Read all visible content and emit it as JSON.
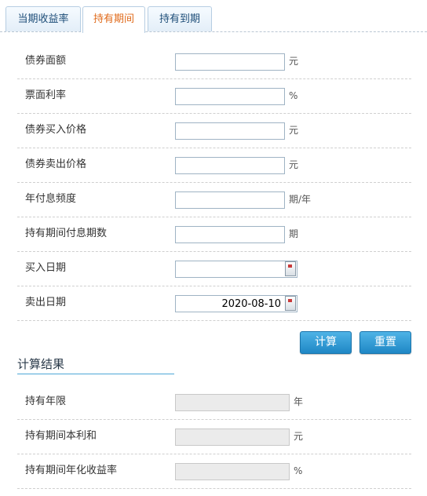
{
  "tabs": [
    {
      "label": "当期收益率"
    },
    {
      "label": "持有期间"
    },
    {
      "label": "持有到期"
    }
  ],
  "active_tab": 1,
  "colors": {
    "active_tab_text": "#e06a1a",
    "tab_text": "#1d4d78",
    "button": "#2a95d2"
  },
  "form": {
    "face_value": {
      "label": "债券面额",
      "unit": "元",
      "value": ""
    },
    "coupon_rate": {
      "label": "票面利率",
      "unit": "%",
      "value": ""
    },
    "buy_price": {
      "label": "债券买入价格",
      "unit": "元",
      "value": ""
    },
    "sell_price": {
      "label": "债券卖出价格",
      "unit": "元",
      "value": ""
    },
    "payment_freq": {
      "label": "年付息频度",
      "unit": "期/年",
      "value": ""
    },
    "payment_periods": {
      "label": "持有期间付息期数",
      "unit": "期",
      "value": ""
    },
    "buy_date": {
      "label": "买入日期",
      "value": "",
      "icon": "calendar-icon"
    },
    "sell_date": {
      "label": "卖出日期",
      "value": "2020-08-10",
      "icon": "calendar-icon"
    }
  },
  "buttons": {
    "calculate": "计算",
    "reset": "重置"
  },
  "result": {
    "title": "计算结果",
    "holding_years": {
      "label": "持有年限",
      "unit": "年",
      "value": ""
    },
    "principal_interest": {
      "label": "持有期间本利和",
      "unit": "元",
      "value": ""
    },
    "annual_yield": {
      "label": "持有期间年化收益率",
      "unit": "%",
      "value": ""
    }
  }
}
